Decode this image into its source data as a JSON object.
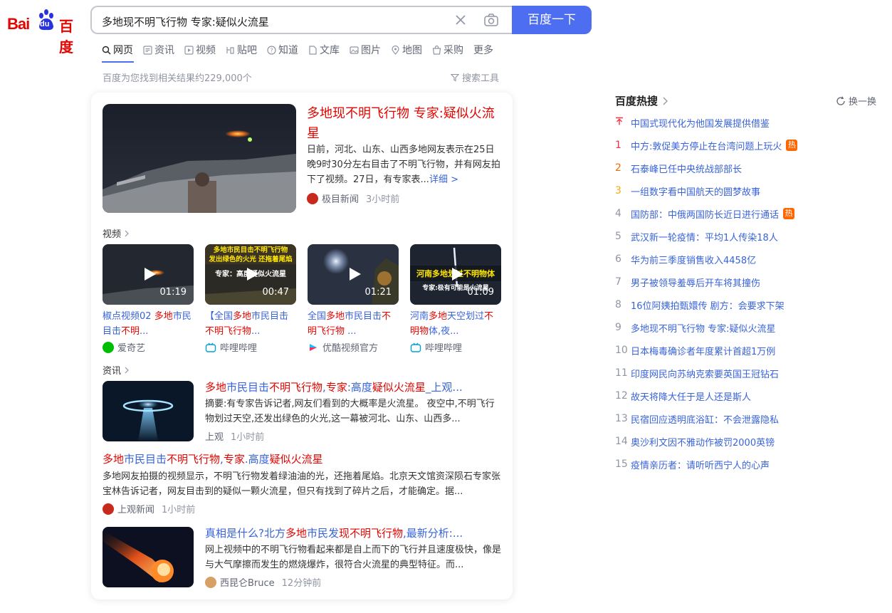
{
  "logo": {
    "latin": "Bai",
    "du": "du",
    "cn": "百度"
  },
  "search": {
    "query": "多地现不明飞行物 专家:疑似火流星",
    "button": "百度一下"
  },
  "tabs": [
    "网页",
    "资讯",
    "视频",
    "贴吧",
    "知道",
    "文库",
    "图片",
    "地图",
    "采购",
    "更多"
  ],
  "result_count": "百度为您找到相关结果约229,000个",
  "tools_label": "搜索工具",
  "top_result": {
    "title": "多地现不明飞行物 专家:疑似火流星",
    "abstract": "日前，河北、山东、山西多地网友表示在25日晚9时30分左右目击了不明飞行物，并有网友拍下了视频。27日，有专家表...",
    "more": "详细 >",
    "source": "极目新闻",
    "time": "3小时前"
  },
  "video_section": {
    "label": "视频",
    "items": [
      {
        "duration": "01:19",
        "t1": "椒点视频02 ",
        "h1": "多地",
        "t2": "市民目击",
        "h2": "不明",
        "t3": "...",
        "source": "爱奇艺"
      },
      {
        "duration": "00:47",
        "t1": "【全国",
        "h1": "多地",
        "t2": "市民目击",
        "h2": "不明飞行物",
        "t3": "...",
        "source": "哔哩哔哩",
        "overlay1": "多地市民目击不明飞行物",
        "overlay2": "发出绿色的火光 还拖着尾焰",
        "overlay3": "专家：高度疑似火流星"
      },
      {
        "duration": "01:21",
        "t1": "全国",
        "h1": "多地",
        "t2": "市民目击",
        "h2": "不明飞行物",
        "t3": " ...",
        "source": "优酷视频官方"
      },
      {
        "duration": "01:09",
        "t1": "河南",
        "h1": "多地",
        "t2": "天空划过",
        "h2": "不明物",
        "t3": "体,夜...",
        "source": "哔哩哔哩",
        "overlay1": "河南多地划过不明物体",
        "overlay2": "专家:极有可能是火流星"
      }
    ]
  },
  "news_section": {
    "label": "资讯",
    "items": [
      {
        "title_parts": [
          [
            "多地",
            true
          ],
          [
            "市民目击",
            false
          ],
          [
            "不明飞行物",
            true
          ],
          [
            ",",
            false
          ],
          [
            "专家",
            true
          ],
          [
            ":高度",
            false
          ],
          [
            "疑似火流星",
            true
          ],
          [
            "_上观...",
            false
          ]
        ],
        "abstract": "摘要:有专家告诉记者,网友们看到的大概率是火流星。 夜空中,不明飞行物划过天空,还发出绿色的火光,这一幕被河北、山东、山西多...",
        "source": "上观",
        "time": "1小时前"
      },
      {
        "title_parts": [
          [
            "多地",
            true
          ],
          [
            "市民目击",
            false
          ],
          [
            "不明飞行物",
            true
          ],
          [
            ",",
            false
          ],
          [
            "专家",
            true
          ],
          [
            ".高度",
            false
          ],
          [
            "疑似火流星",
            true
          ]
        ],
        "abstract": "多地网友拍摄的视频显示，不明飞行物发着绿油油的光，还拖着尾焰。北京天文馆资深陨石专家张宝林告诉记者，网友目击到的疑似一颗火流星，但只有找到了碎片之后，才能确定。据...",
        "source": "上观新闻",
        "time": "1小时前"
      },
      {
        "title_parts": [
          [
            "真相是什么?北方",
            false
          ],
          [
            "多地",
            true
          ],
          [
            "市民发",
            false
          ],
          [
            "现不明飞行物",
            true
          ],
          [
            ",最新分析:...",
            false
          ]
        ],
        "abstract": "网上视频中的不明飞行物看起来都是自上而下的飞行并且速度极快，像是与大气摩擦而发生的燃烧爆炸，很符合火流星的典型特征。而...",
        "source": "西昆仑Bruce",
        "time": "12分钟前"
      }
    ]
  },
  "hot_list": {
    "title": "百度热搜",
    "refresh": "换一换",
    "items": [
      {
        "rank": "",
        "text": "中国式现代化为他国发展提供借鉴",
        "badge": ""
      },
      {
        "rank": "1",
        "text": "中方:敦促美方停止在台湾问题上玩火",
        "badge": "热"
      },
      {
        "rank": "2",
        "text": "石泰峰已任中央统战部部长",
        "badge": ""
      },
      {
        "rank": "3",
        "text": "一组数字看中国航天的圆梦故事",
        "badge": ""
      },
      {
        "rank": "4",
        "text": "国防部：中俄两国防长近日进行通话",
        "badge": "热"
      },
      {
        "rank": "5",
        "text": "武汉新一轮疫情：平均1人传染18人",
        "badge": ""
      },
      {
        "rank": "6",
        "text": "华为前三季度销售收入4458亿",
        "badge": ""
      },
      {
        "rank": "7",
        "text": "男子被领导羞辱后开车将其撞伤",
        "badge": ""
      },
      {
        "rank": "8",
        "text": "16位阿姨拍甄嬛传 剧方：会要求下架",
        "badge": ""
      },
      {
        "rank": "9",
        "text": "多地现不明飞行物 专家:疑似火流星",
        "badge": ""
      },
      {
        "rank": "10",
        "text": "日本梅毒确诊者年度累计首超1万例",
        "badge": ""
      },
      {
        "rank": "11",
        "text": "印度网民向苏纳克索要英国王冠钻石",
        "badge": ""
      },
      {
        "rank": "12",
        "text": "故天将降大任于是人还是斯人",
        "badge": ""
      },
      {
        "rank": "13",
        "text": "民宿回应透明底浴缸：不会泄露隐私",
        "badge": ""
      },
      {
        "rank": "14",
        "text": "奥沙利文因不雅动作被罚2000英镑",
        "badge": ""
      },
      {
        "rank": "15",
        "text": "疫情亲历者：请听听西宁人的心声",
        "badge": ""
      }
    ]
  }
}
